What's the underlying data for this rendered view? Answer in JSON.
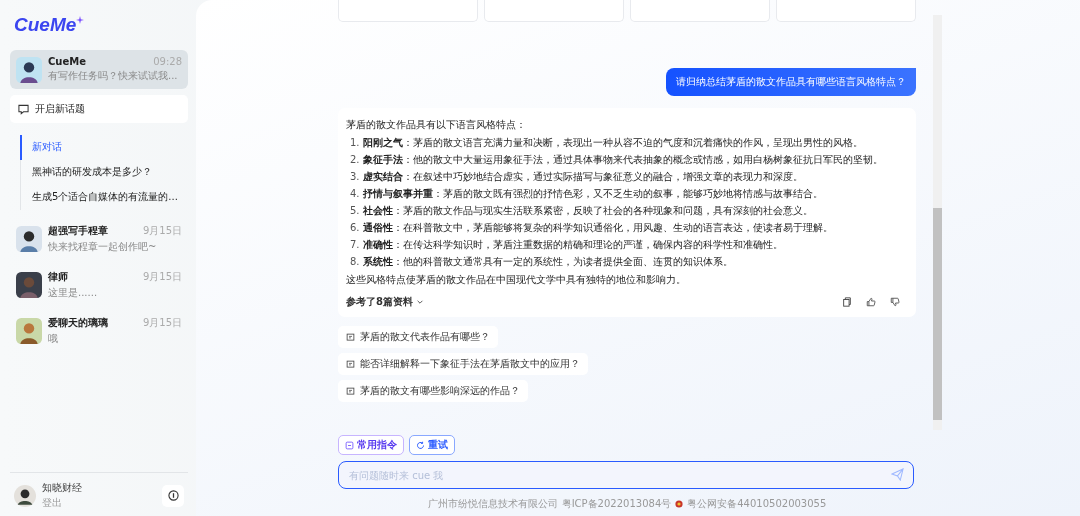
{
  "logo": "CueMe",
  "pinned_chat": {
    "name": "CueMe",
    "time": "09:28",
    "preview": "有写作任务吗？快来试试我...",
    "selected": true
  },
  "new_topic_button": "开启新话题",
  "topics": [
    {
      "title": "新对话",
      "selected": true
    },
    {
      "title": "黑神话的研发成本是多少？",
      "selected": false
    },
    {
      "title": "生成5个适合自媒体的有流量的...",
      "selected": false
    }
  ],
  "chats": [
    {
      "name": "超强写手程章",
      "date": "9月15日",
      "preview": "快来找程章一起创作吧~"
    },
    {
      "name": "律师",
      "date": "9月15日",
      "preview": "这里是......"
    },
    {
      "name": "爱聊天的璃璃",
      "date": "9月15日",
      "preview": "哦"
    }
  ],
  "user": {
    "name": "知晓财经",
    "action": "登出"
  },
  "top_cards": [
    {
      "kind": "card"
    },
    {
      "kind": "card"
    },
    {
      "kind": "card"
    },
    {
      "kind": "card"
    }
  ],
  "user_message": "请归纳总结茅盾的散文作品具有哪些语言风格特点？",
  "answer": {
    "intro": "茅盾的散文作品具有以下语言风格特点：",
    "points": [
      {
        "number": "1.",
        "text": "**阳刚之气**：茅盾的散文语言充满力量和决断，表现出一种从容不迫的气度和沉着痛快的作风，呈现出男性的风格。"
      },
      {
        "number": "2.",
        "text": "**象征手法**：他的散文中大量运用象征手法，通过具体事物来代表抽象的概念或情感，如用白杨树象征抗日军民的坚韧。"
      },
      {
        "number": "3.",
        "text": "**虚实结合**：在叙述中巧妙地结合虚实，通过实际描写与象征意义的融合，增强文章的表现力和深度。"
      },
      {
        "number": "4.",
        "text": "**抒情与叙事并重**：茅盾的散文既有强烈的抒情色彩，又不乏生动的叙事，能够巧妙地将情感与故事结合。"
      },
      {
        "number": "5.",
        "text": "**社会性**：茅盾的散文作品与现实生活联系紧密，反映了社会的各种现象和问题，具有深刻的社会意义。"
      },
      {
        "number": "6.",
        "text": "**通俗性**：在科普散文中，茅盾能够将复杂的科学知识通俗化，用风趣、生动的语言表达，使读者易于理解。"
      },
      {
        "number": "7.",
        "text": "**准确性**：在传达科学知识时，茅盾注重数据的精确和理论的严谨，确保内容的科学性和准确性。"
      },
      {
        "number": "8.",
        "text": "**系统性**：他的科普散文通常具有一定的系统性，为读者提供全面、连贯的知识体系。"
      }
    ],
    "conclusion": "这些风格特点使茅盾的散文作品在中国现代文学中具有独特的地位和影响力。",
    "references": "参考了8篇资料"
  },
  "suggestions": [
    "茅盾的散文代表作品有哪些？",
    "能否详细解释一下象征手法在茅盾散文中的应用？",
    "茅盾的散文有哪些影响深远的作品？"
  ],
  "tools": [
    {
      "label": "常用指令",
      "kind": "commands"
    },
    {
      "label": "重试",
      "kind": "retry"
    }
  ],
  "input": {
    "placeholder": "有问题随时来 cue 我"
  },
  "footer": {
    "company": "广州市纷悦信息技术有限公司",
    "icp": "粤ICP备2022013084号",
    "police": "粤公网安备44010502003055"
  }
}
